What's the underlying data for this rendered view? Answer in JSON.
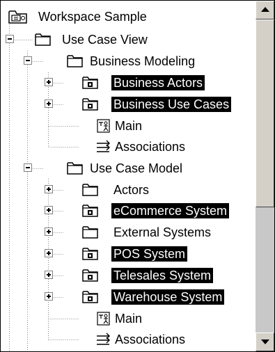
{
  "tree": {
    "rows": [
      {
        "label": "Workspace Sample",
        "icon": "workspace-icon",
        "expander": "none",
        "selected": false
      },
      {
        "label": "Use Case View",
        "icon": "folder-icon",
        "expander": "minus",
        "selected": false
      },
      {
        "label": "Business Modeling",
        "icon": "folder-icon",
        "expander": "minus",
        "selected": false
      },
      {
        "label": "Business Actors",
        "icon": "controlled-folder-icon",
        "expander": "plus",
        "selected": true
      },
      {
        "label": "Business Use Cases",
        "icon": "controlled-folder-icon",
        "expander": "plus",
        "selected": true
      },
      {
        "label": "Main",
        "icon": "diagram-icon",
        "expander": "none",
        "selected": false
      },
      {
        "label": "Associations",
        "icon": "associations-icon",
        "expander": "none",
        "selected": false
      },
      {
        "label": "Use Case Model",
        "icon": "folder-icon",
        "expander": "minus",
        "selected": false
      },
      {
        "label": "Actors",
        "icon": "folder-icon",
        "expander": "plus",
        "selected": false
      },
      {
        "label": "eCommerce System",
        "icon": "controlled-folder-icon",
        "expander": "plus",
        "selected": true
      },
      {
        "label": "External Systems",
        "icon": "folder-icon",
        "expander": "plus",
        "selected": false
      },
      {
        "label": "POS System",
        "icon": "controlled-folder-icon",
        "expander": "plus",
        "selected": true
      },
      {
        "label": "Telesales System",
        "icon": "controlled-folder-icon",
        "expander": "plus",
        "selected": true
      },
      {
        "label": "Warehouse System",
        "icon": "controlled-folder-icon",
        "expander": "plus",
        "selected": true
      },
      {
        "label": "Main",
        "icon": "diagram-icon",
        "expander": "none",
        "selected": false
      },
      {
        "label": "Associations",
        "icon": "associations-icon",
        "expander": "none",
        "selected": false
      }
    ]
  },
  "scrollbar": {
    "thumb_position_fraction": 0.0,
    "visible_fraction": 0.6
  }
}
